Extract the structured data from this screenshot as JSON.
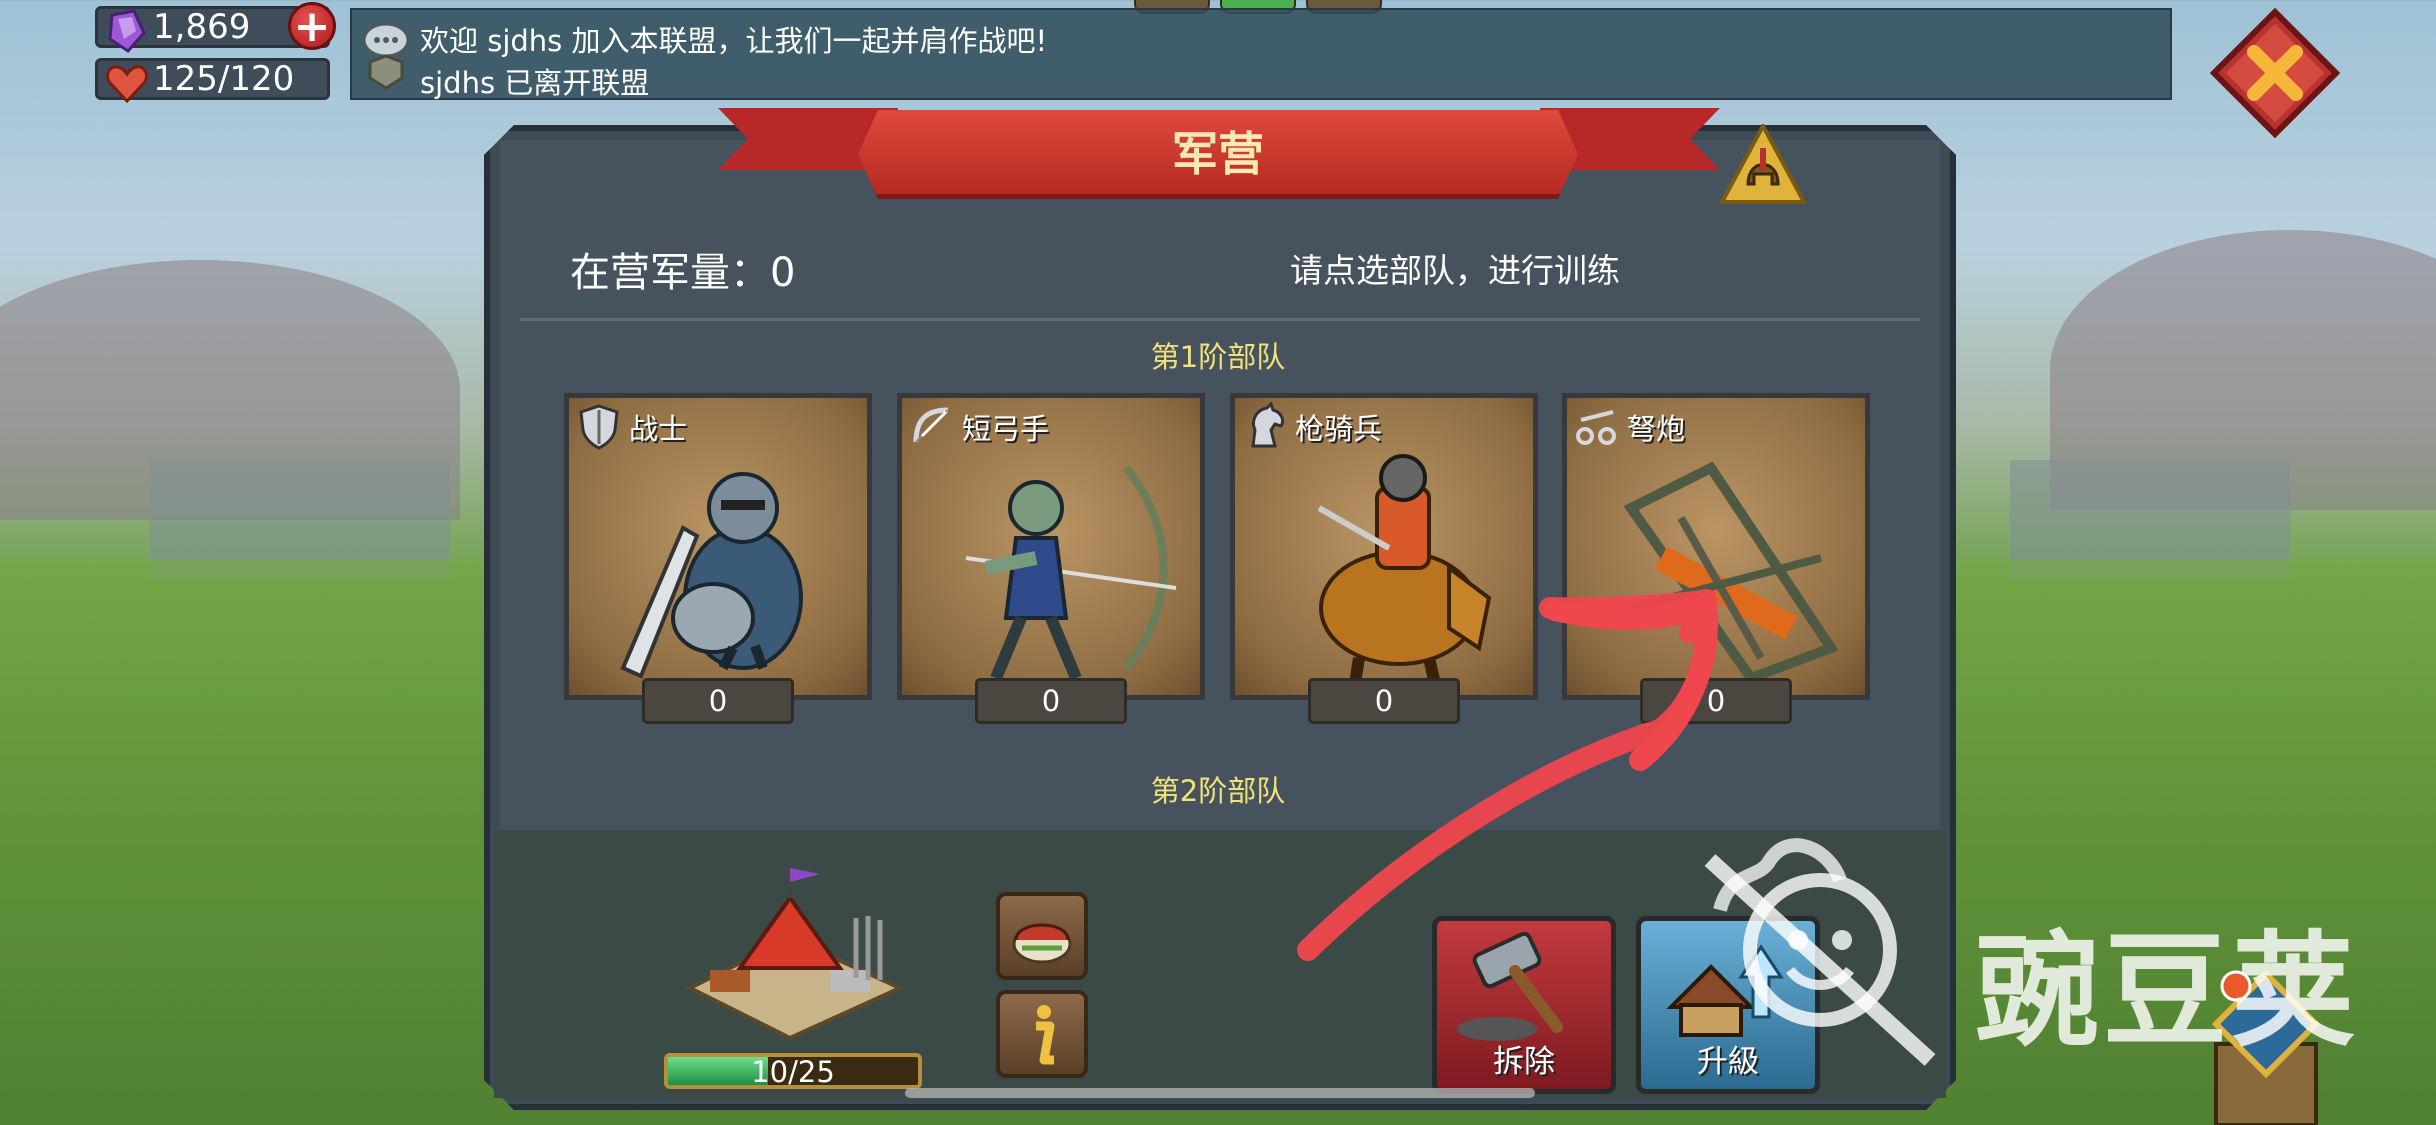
{
  "resources": {
    "gems": "1,869",
    "stamina": "125/120",
    "gem_icon": "purple-gem-icon",
    "stamina_icon": "heart-icon",
    "add_icon": "plus-icon"
  },
  "messages": [
    "欢迎 sjdhs 加入本联盟，让我们一起并肩作战吧!",
    "sjdhs 已离开联盟"
  ],
  "panel": {
    "title": "军营",
    "troops_label": "在营军量：0",
    "hint": "请点选部队，进行训练"
  },
  "tiers": {
    "tier1": "第1阶部队",
    "tier2": "第2阶部队"
  },
  "units": [
    {
      "name": "战士",
      "count": "0",
      "icon": "shield-icon"
    },
    {
      "name": "短弓手",
      "count": "0",
      "icon": "bow-icon"
    },
    {
      "name": "枪骑兵",
      "count": "0",
      "icon": "horse-icon"
    },
    {
      "name": "弩炮",
      "count": "0",
      "icon": "catapult-icon"
    }
  ],
  "building": {
    "progress_text": "10/25",
    "progress_fraction": 0.4
  },
  "buttons": {
    "demolish": "拆除",
    "upgrade": "升級"
  },
  "watermark": "豌豆荚",
  "colors": {
    "title_ribbon": "#c9352b",
    "tier_label": "#f2e07a",
    "progress_fill": "#2fae5a",
    "demolish_button": "#a8242c",
    "upgrade_button": "#4a8fb5",
    "annotation_arrow": "#f0464e"
  }
}
